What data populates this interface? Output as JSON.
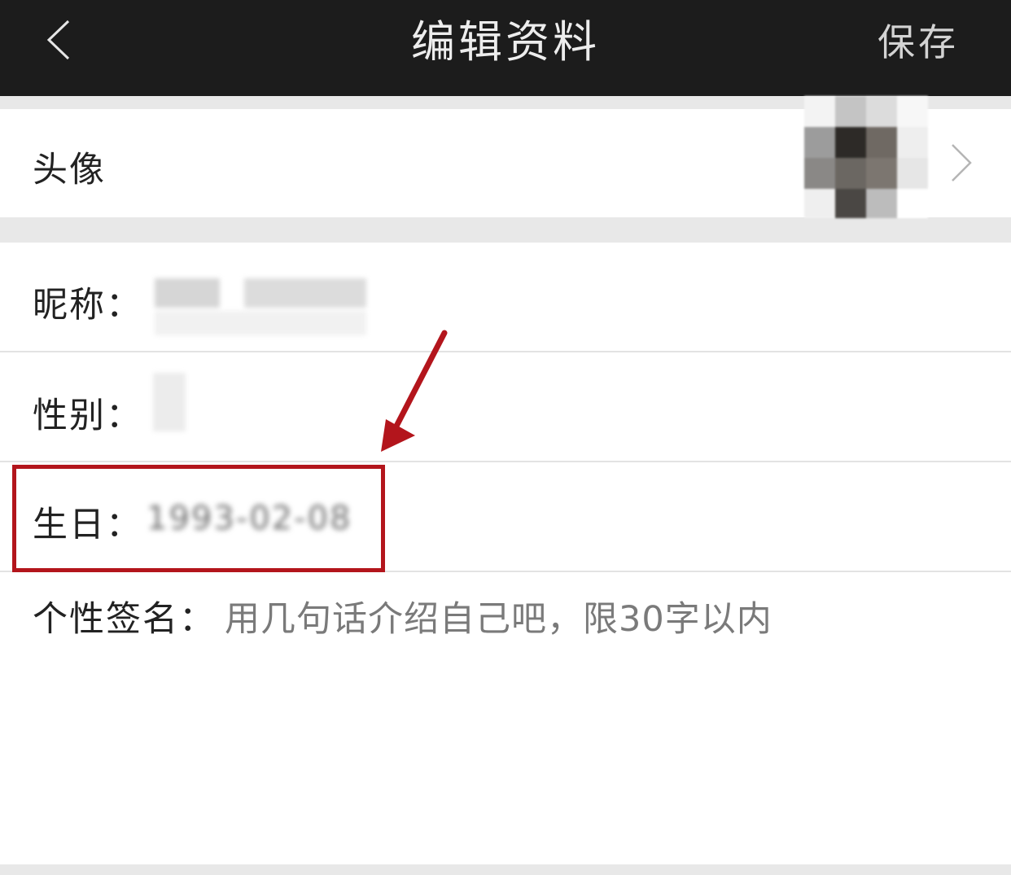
{
  "header": {
    "back_icon": "chevron-left-icon",
    "title": "编辑资料",
    "save_label": "保存"
  },
  "colors": {
    "nav_background": "#1c1c1c",
    "page_background": "#e8e8e8",
    "highlight": "#b3151c"
  },
  "profile": {
    "avatar_label": "头像",
    "avatar_chevron_icon": "chevron-right-icon",
    "nickname_label": "昵称：",
    "gender_label": "性别：",
    "birthday_label": "生日：",
    "birthday_value": "1993-02-08",
    "signature_label": "个性签名：",
    "signature_placeholder": "用几句话介绍自己吧，限30字以内"
  }
}
